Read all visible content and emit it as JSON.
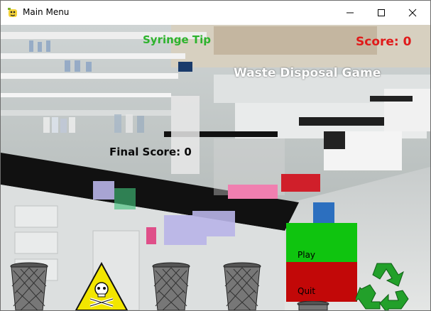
{
  "window": {
    "title": "Main Menu"
  },
  "hud": {
    "item_label": "Syringe Tip",
    "score_label": "Score: 0",
    "game_title": "Waste Disposal Game",
    "final_score_label": "Final Score: 0"
  },
  "menu": {
    "play_label": "Play",
    "quit_label": "Quit"
  },
  "colors": {
    "item_text": "#2db32d",
    "score_text": "#e01a1a",
    "title_text": "#ffffff",
    "final_text": "#0a0a0a",
    "play_bg": "#0fc40f",
    "quit_bg": "#c20808",
    "recycle": "#22a02a",
    "hazard": "#f2e600"
  },
  "bins": [
    "trash-bin-icon",
    "biohazard-bin-icon",
    "trash-bin-icon",
    "trash-bin-icon",
    "trash-bin-icon",
    "recycle-bin-icon"
  ]
}
